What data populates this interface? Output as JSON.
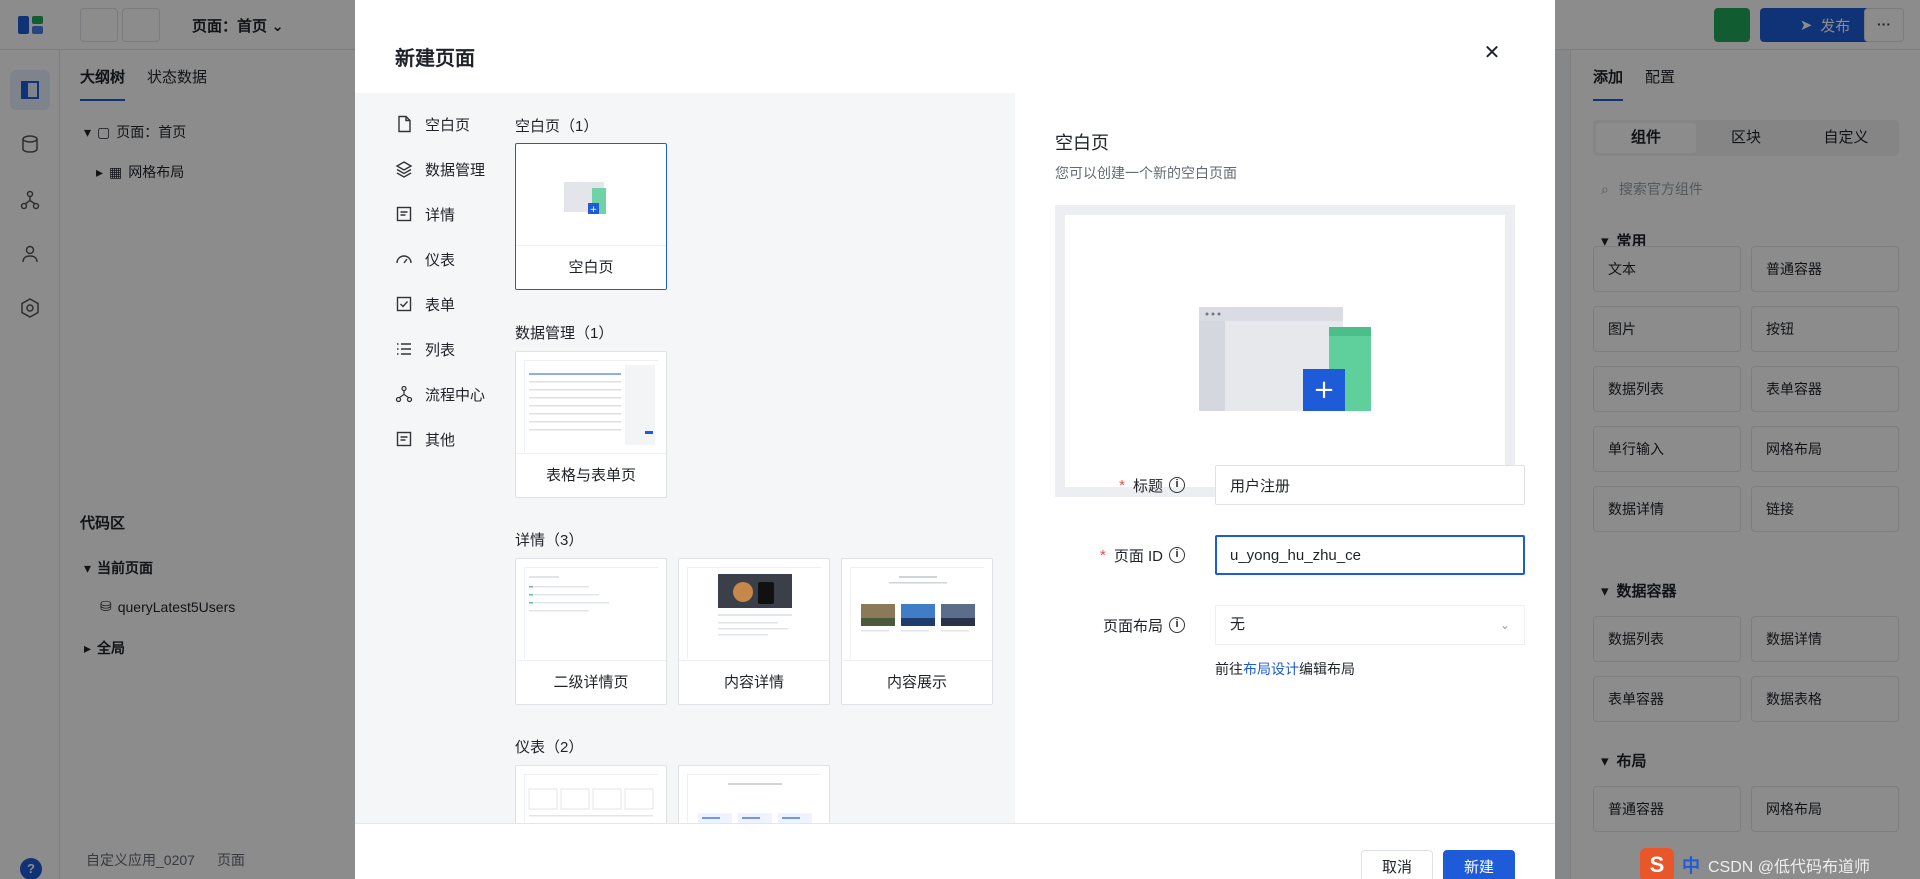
{
  "topbar": {
    "page_select": "页面：首页",
    "publish_label": "发布",
    "more_label": "···"
  },
  "left_panel": {
    "tabs": [
      "大纲树",
      "状态数据"
    ],
    "tree": [
      {
        "label": "页面：首页"
      },
      {
        "label": "网格布局"
      }
    ],
    "code_area": {
      "title": "代码区",
      "current_page": "当前页面",
      "query": "queryLatest5Users",
      "global": "全局"
    },
    "footer_path": [
      "自定义应用_0207",
      "页面"
    ]
  },
  "right_panel": {
    "tabs": [
      "添加",
      "配置"
    ],
    "segments": [
      "组件",
      "区块",
      "自定义"
    ],
    "search_placeholder": "搜索官方组件",
    "groups": [
      {
        "title": "常用",
        "items": [
          "文本",
          "普通容器",
          "图片",
          "按钮",
          "数据列表",
          "表单容器",
          "单行输入",
          "网格布局",
          "数据详情",
          "链接"
        ]
      },
      {
        "title": "数据容器",
        "items": [
          "数据列表",
          "数据详情",
          "表单容器",
          "数据表格"
        ]
      },
      {
        "title": "布局",
        "items": [
          "普通容器",
          "网格布局"
        ]
      }
    ]
  },
  "dialog": {
    "title": "新建页面",
    "categories": [
      "空白页",
      "数据管理",
      "详情",
      "仪表",
      "表单",
      "列表",
      "流程中心",
      "其他"
    ],
    "sections": [
      {
        "title": "空白页（1）",
        "templates": [
          "空白页"
        ]
      },
      {
        "title": "数据管理（1）",
        "templates": [
          "表格与表单页"
        ]
      },
      {
        "title": "详情（3）",
        "templates": [
          "二级详情页",
          "内容详情",
          "内容展示"
        ]
      },
      {
        "title": "仪表（2）",
        "templates": []
      }
    ],
    "detail": {
      "title": "空白页",
      "description": "您可以创建一个新的空白页面"
    },
    "form": {
      "title_label": "标题",
      "title_value": "用户注册",
      "id_label": "页面 ID",
      "id_value": "u_yong_hu_zhu_ce",
      "layout_label": "页面布局",
      "layout_value": "无",
      "layout_hint_prefix": "前往",
      "layout_hint_link": "布局设计",
      "layout_hint_suffix": "编辑布局"
    },
    "buttons": {
      "cancel": "取消",
      "create": "新建"
    }
  },
  "watermark": {
    "zh": "中",
    "text": "CSDN @低代码布道师"
  },
  "colors": {
    "primary": "#1e5bd8",
    "run": "#21a85c",
    "required": "#f54a45"
  }
}
